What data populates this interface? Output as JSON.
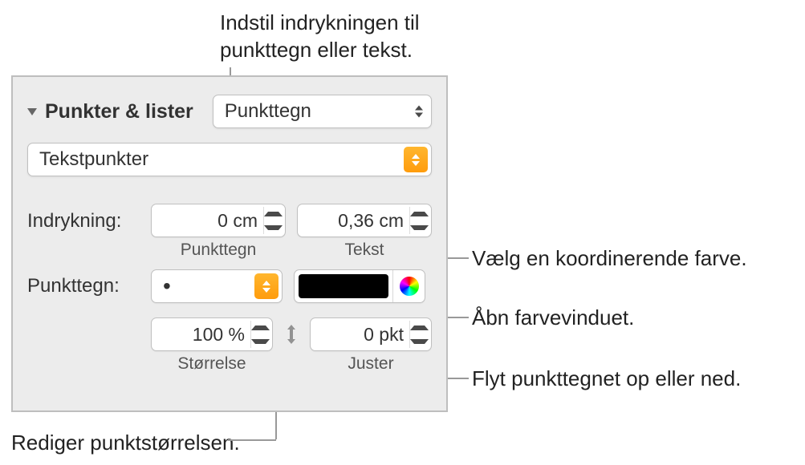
{
  "callouts": {
    "indent": "Indstil indrykningen til punkttegn eller tekst.",
    "coord_color": "Vælg en koordinerende farve.",
    "open_color_window": "Åbn farvevinduet.",
    "move_bullet": "Flyt punkttegnet op eller ned.",
    "edit_size": "Rediger punktstørrelsen."
  },
  "panel": {
    "section_title": "Punkter & lister",
    "list_type": "Punkttegn",
    "bullet_style": "Tekstpunkter",
    "indent_label": "Indrykning:",
    "indent_bullet_value": "0 cm",
    "indent_bullet_sub": "Punkttegn",
    "indent_text_value": "0,36 cm",
    "indent_text_sub": "Tekst",
    "bullet_label": "Punkttegn:",
    "bullet_char": "•",
    "size_value": "100 %",
    "size_sub": "Størrelse",
    "align_value": "0 pkt",
    "align_sub": "Juster"
  }
}
